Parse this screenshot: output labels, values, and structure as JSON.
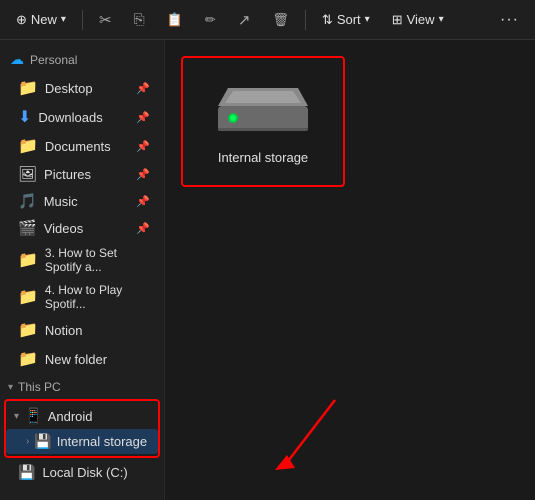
{
  "toolbar": {
    "new_label": "New",
    "sort_label": "Sort",
    "view_label": "View",
    "icons": {
      "cut": "✂",
      "copy": "⎘",
      "paste": "📋",
      "rename": "✏",
      "share": "↗",
      "delete": "🗑",
      "more": "···"
    }
  },
  "sidebar": {
    "cloud_label": "Personal",
    "items": [
      {
        "label": "Desktop",
        "icon": "📁",
        "color": "blue",
        "pinned": true
      },
      {
        "label": "Downloads",
        "icon": "⬇",
        "color": "blue",
        "pinned": true
      },
      {
        "label": "Documents",
        "icon": "📁",
        "color": "blue",
        "pinned": true
      },
      {
        "label": "Pictures",
        "icon": "🖼",
        "color": "blue",
        "pinned": true
      },
      {
        "label": "Music",
        "icon": "🎵",
        "color": "green",
        "pinned": true
      },
      {
        "label": "Videos",
        "icon": "🎬",
        "color": "red",
        "pinned": true
      },
      {
        "label": "3. How to Set Spotify a...",
        "icon": "📁",
        "color": "yellow",
        "pinned": false
      },
      {
        "label": "4. How to Play Spotif...",
        "icon": "📁",
        "color": "yellow",
        "pinned": false
      },
      {
        "label": "Notion",
        "icon": "📁",
        "color": "blue",
        "pinned": false
      },
      {
        "label": "New folder",
        "icon": "📁",
        "color": "yellow",
        "pinned": false
      }
    ],
    "this_pc_label": "This PC",
    "android_label": "Android",
    "internal_storage_label": "Internal storage",
    "local_disk_label": "Local Disk (C:)"
  },
  "content": {
    "storage_label": "Internal storage"
  }
}
